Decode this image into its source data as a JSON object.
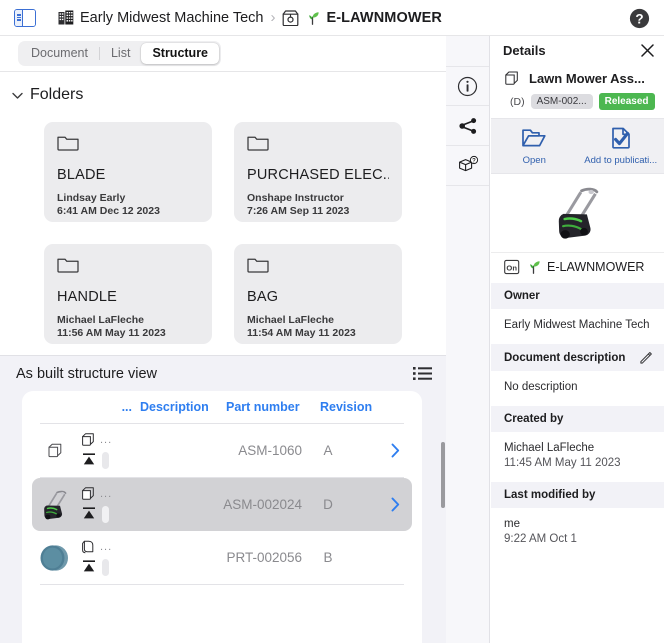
{
  "topbar": {
    "panel_toggle_icon": "sidebar-toggle-icon",
    "help_icon": "help-circle-icon",
    "breadcrumb": [
      {
        "icon": "building-icon",
        "label": "Early Midwest Machine Tech",
        "bold": false
      },
      {
        "icon": "document-box-icon",
        "label": "E-LAWNMOWER",
        "bold": true,
        "extra_icon": "sprout-icon"
      }
    ],
    "separator": "›"
  },
  "tabs": [
    {
      "label": "Document",
      "selected": false
    },
    {
      "label": "List",
      "selected": false
    },
    {
      "label": "Structure",
      "selected": true
    }
  ],
  "folders_section": {
    "title": "Folders",
    "collapse_icon": "chevron-down-icon",
    "cards": [
      {
        "icon": "folder-icon",
        "name": "BLADE",
        "owner": "Lindsay Early",
        "date": "6:41 AM Dec 12 2023"
      },
      {
        "icon": "folder-icon",
        "name": "PURCHASED ELEC...",
        "owner": "Onshape Instructor",
        "date": "7:26 AM Sep 11 2023"
      },
      {
        "icon": "folder-icon",
        "name": "HANDLE",
        "owner": "Michael LaFleche",
        "date": "11:56 AM May 11 2023"
      },
      {
        "icon": "folder-icon",
        "name": "BAG",
        "owner": "Michael LaFleche",
        "date": "11:54 AM May 11 2023"
      }
    ]
  },
  "as_built": {
    "title": "As built structure view",
    "list_view_icon": "list-view-icon",
    "columns": [
      "...",
      "Description",
      "Part number",
      "Revision"
    ],
    "rows": [
      {
        "thumbnail": "assembly-icon",
        "row_icon": "assembly-stack-icon",
        "dots": "...",
        "release_icon": "release-triangle-icon",
        "description": "",
        "part_number": "ASM-1060",
        "revision": "A",
        "arrow_icon": "chevron-right-icon",
        "selected": false,
        "show_arrow": true
      },
      {
        "thumbnail": "lawnmower-thumbnail",
        "row_icon": "assembly-stack-icon",
        "dots": "...",
        "release_icon": "release-triangle-icon",
        "description": "",
        "part_number": "ASM-002024",
        "revision": "D",
        "arrow_icon": "chevron-right-icon",
        "selected": true,
        "show_arrow": true
      },
      {
        "thumbnail": "blue-disc-thumbnail",
        "row_icon": "part-icon",
        "dots": "...",
        "release_icon": "release-triangle-icon",
        "description": "",
        "part_number": "PRT-002056",
        "revision": "B",
        "arrow_icon": "chevron-right-icon",
        "selected": false,
        "show_arrow": false
      }
    ]
  },
  "rail": [
    {
      "icon": "info-circle-icon",
      "name": "info",
      "active": true
    },
    {
      "icon": "share-icon",
      "name": "share",
      "active": false
    },
    {
      "icon": "cube-question-icon",
      "name": "where-used",
      "active": false
    }
  ],
  "details": {
    "title": "Details",
    "close_icon": "close-icon",
    "document": {
      "icon": "assembly-stack-icon",
      "name": "Lawn Mower Ass...",
      "release_icon": "release-triangle-icon",
      "revision": "(D)",
      "part_number": "ASM-002...",
      "state": "Released",
      "state_color": "#4cb750"
    },
    "actions": [
      {
        "icon": "open-folder-icon",
        "label": "Open"
      },
      {
        "icon": "add-publication-icon",
        "label": "Add to publicati..."
      }
    ],
    "preview": {
      "icon": "lawnmower-thumbnail"
    },
    "item": {
      "badge_icon": "onshape-badge-icon",
      "sprout_icon": "sprout-icon",
      "name": "E-LAWNMOWER"
    },
    "sections": [
      {
        "label": "Owner",
        "value": "Early Midwest Machine Tech",
        "sub": "",
        "editable": false
      },
      {
        "label": "Document description",
        "value": "No description",
        "sub": "",
        "editable": true,
        "edit_icon": "pencil-icon"
      },
      {
        "label": "Created by",
        "value": "Michael LaFleche",
        "sub": "11:45 AM May 11 2023",
        "editable": false
      },
      {
        "label": "Last modified by",
        "value": "me",
        "sub": "9:22 AM Oct 1",
        "editable": false
      }
    ]
  },
  "colors": {
    "accent": "#2e7ef0",
    "link": "#2f5fad",
    "released": "#4cb750",
    "panel_bg": "#f2f2f7"
  }
}
